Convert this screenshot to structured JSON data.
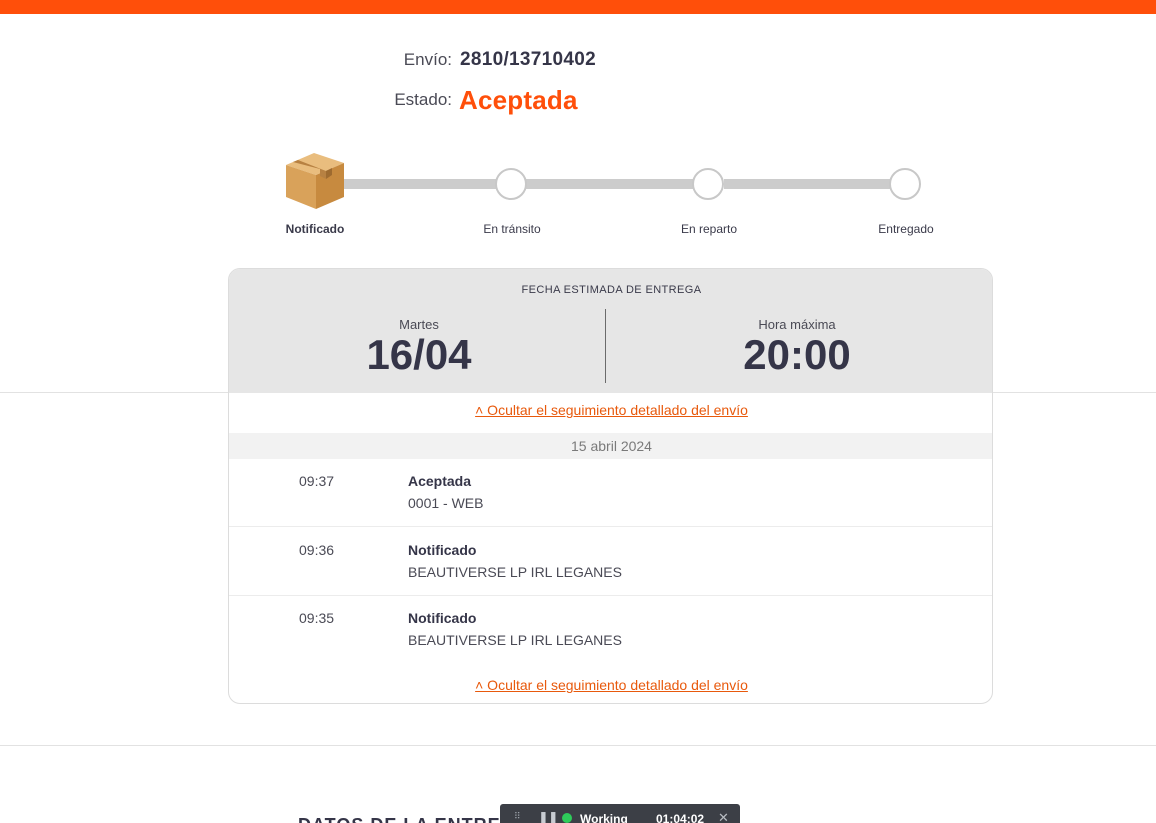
{
  "colors": {
    "brand": "#ff4f0a",
    "link": "#e8590c",
    "status_green": "#2ecc5a"
  },
  "shipment": {
    "envio_label": "Envío:",
    "envio_value": "2810/13710402",
    "estado_label": "Estado:",
    "estado_value": "Aceptada"
  },
  "progress": {
    "current_step": 0,
    "steps": [
      {
        "label": "Notificado",
        "icon": "package-box-icon"
      },
      {
        "label": "En tránsito"
      },
      {
        "label": "En reparto"
      },
      {
        "label": "Entregado"
      }
    ]
  },
  "estimate": {
    "title": "FECHA ESTIMADA DE ENTREGA",
    "day_label": "Martes",
    "date": "16/04",
    "hour_label": "Hora máxima",
    "hour": "20:00"
  },
  "tracking": {
    "toggle_link": "˄ Ocultar el seguimiento detallado del envío",
    "date_group": "15 abril 2024",
    "events": [
      {
        "time": "09:37",
        "status": "Aceptada",
        "detail": "0001 - WEB"
      },
      {
        "time": "09:36",
        "status": "Notificado",
        "detail": "BEAUTIVERSE LP IRL LEGANES"
      },
      {
        "time": "09:35",
        "status": "Notificado",
        "detail": "BEAUTIVERSE LP IRL LEGANES"
      }
    ]
  },
  "bottom_section": {
    "heading_partial": "DATOS DE LA ENTREGA"
  },
  "work_toolbar": {
    "status": "Working",
    "timer": "01:04:02",
    "icons": [
      "grip-icon",
      "pause-icon",
      "status-dot-icon",
      "close-icon"
    ]
  }
}
